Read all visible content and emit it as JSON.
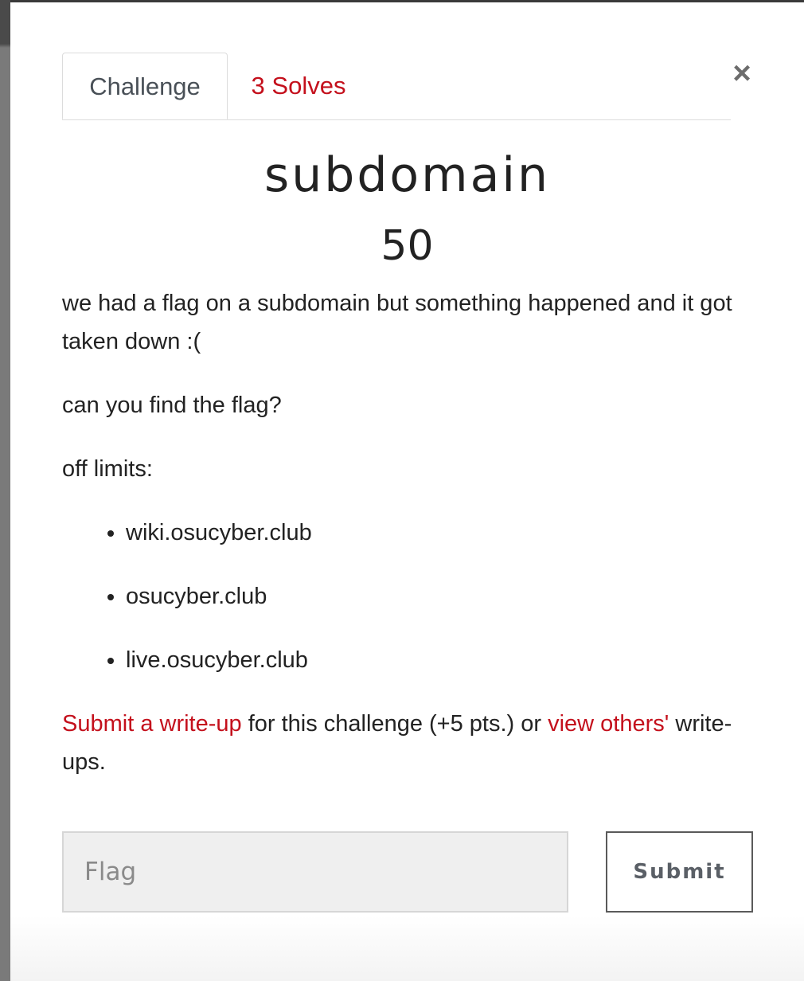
{
  "tabs": {
    "challenge_label": "Challenge",
    "solves_label": "3 Solves"
  },
  "close_label": "×",
  "challenge": {
    "name": "subdomain",
    "points": "50",
    "description_paragraph_1": "we had a flag on a subdomain but something happened and it got taken down :(",
    "description_paragraph_2": "can you find the flag?",
    "description_paragraph_3": "off limits:",
    "off_limits": [
      "wiki.osucyber.club",
      "osucyber.club",
      "live.osucyber.club"
    ],
    "writeup": {
      "submit_link": "Submit a write-up",
      "middle_text": " for this challenge (+5 pts.) or ",
      "view_link": "view others'",
      "end_text": " write-ups."
    }
  },
  "form": {
    "flag_placeholder": "Flag",
    "flag_value": "",
    "submit_label": "Submit"
  },
  "colors": {
    "accent": "#c4101c",
    "text": "#222222",
    "input_bg": "#efefef"
  }
}
